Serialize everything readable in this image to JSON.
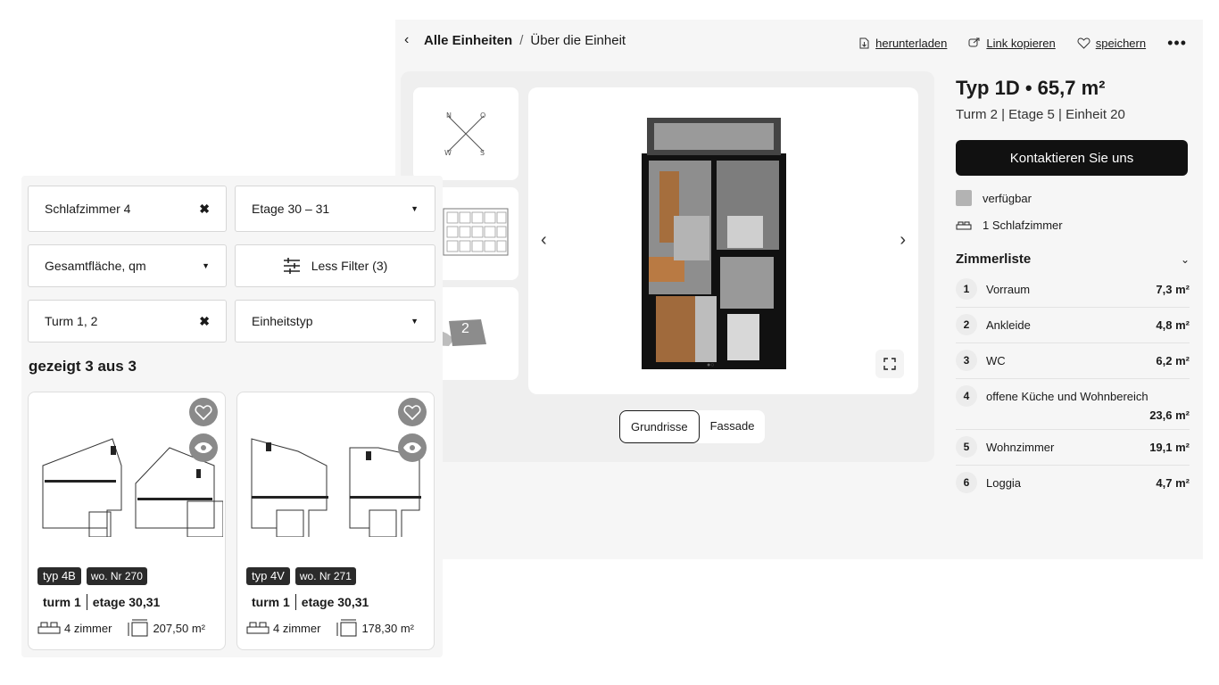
{
  "header": {
    "breadcrumb_parent": "Alle Einheiten",
    "breadcrumb_separator": "/",
    "breadcrumb_current": "Über die Einheit",
    "actions": {
      "download": "herunterladen",
      "copy_link": "Link kopieren",
      "save": "speichern",
      "more": "•••"
    }
  },
  "gallery": {
    "tower_badge": "2",
    "tabs": [
      "Grundrisse",
      "Fassade"
    ],
    "active_tab": "Grundrisse"
  },
  "unit": {
    "title": "Typ 1D • 65,7 m²",
    "subtitle": "Turm 2 | Etage 5 | Einheit 20",
    "cta": "Kontaktieren Sie uns",
    "status": "verfügbar",
    "status_color": "#b3b3b3",
    "bedrooms": "1 Schlafzimmer"
  },
  "rooms": {
    "heading": "Zimmerliste",
    "items": [
      {
        "num": "1",
        "name": "Vorraum",
        "area": "7,3 m²"
      },
      {
        "num": "2",
        "name": "Ankleide",
        "area": "4,8 m²"
      },
      {
        "num": "3",
        "name": "WC",
        "area": "6,2 m²"
      },
      {
        "num": "4",
        "name": "offene Küche und Wohnbereich",
        "area": "23,6 m²"
      },
      {
        "num": "5",
        "name": "Wohnzimmer",
        "area": "19,1 m²"
      },
      {
        "num": "6",
        "name": "Loggia",
        "area": "4,7 m²"
      }
    ]
  },
  "filters": {
    "bedrooms": "Schlafzimmer 4",
    "floor": "Etage 30 – 31",
    "area": "Gesamtfläche, qm",
    "less_filter": "Less Filter (3)",
    "tower": "Turm 1, 2",
    "unit_type": "Einheitstyp",
    "clear_icon": "✖",
    "caret_icon": "▼"
  },
  "results": {
    "count": "gezeigt 3 aus 3",
    "cards": [
      {
        "type": "typ 4B",
        "number": "wo. Nr 270",
        "tower": "turm 1",
        "floor": "etage 30,31",
        "rooms": "4 zimmer",
        "area": "207,50 m²"
      },
      {
        "type": "typ 4V",
        "number": "wo. Nr 271",
        "tower": "turm 1",
        "floor": "etage 30,31",
        "rooms": "4 zimmer",
        "area": "178,30 m²"
      }
    ]
  }
}
